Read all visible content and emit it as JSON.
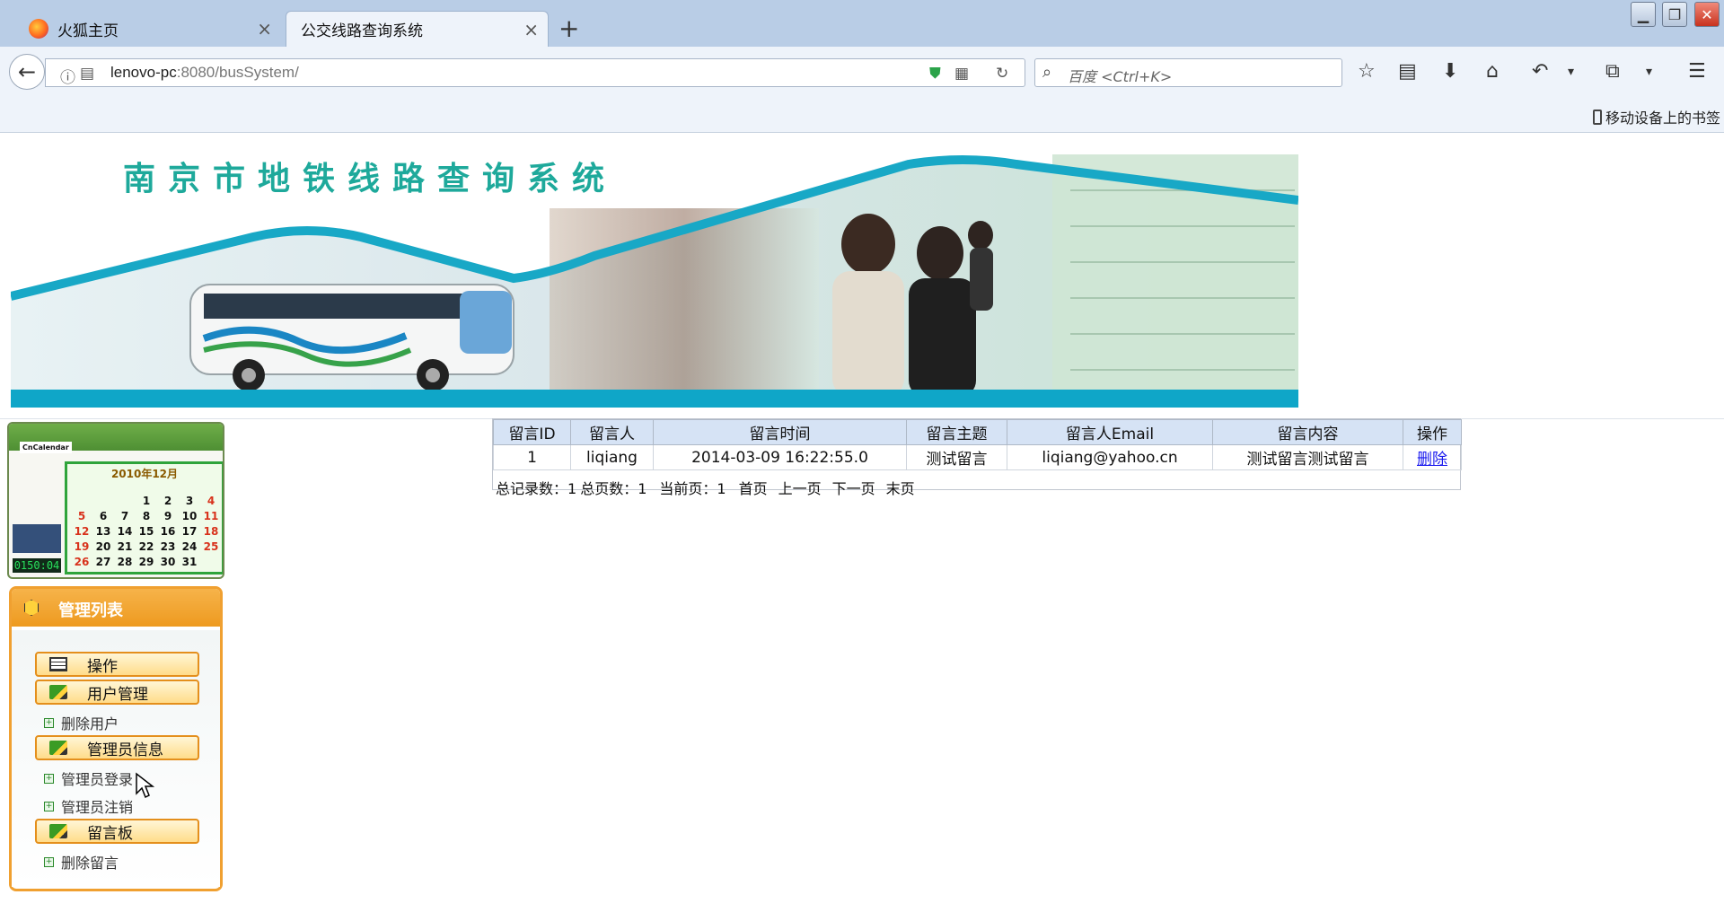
{
  "browser": {
    "tabs": [
      {
        "title": "火狐主页",
        "active": false
      },
      {
        "title": "公交线路查询系统",
        "active": true
      }
    ],
    "url_host": "lenovo-pc",
    "url_rest": ":8080/busSystem/",
    "search_placeholder": "百度 <Ctrl+K>",
    "bookmark_mobile": "移动设备上的书签",
    "new_tab": "+",
    "tab_close": "×"
  },
  "banner": {
    "title": "南京市地铁线路查询系统"
  },
  "calendar": {
    "brand": "CnCalendar",
    "month_title": "2010年12月",
    "days": [
      "",
      "",
      "",
      "1",
      "2",
      "3",
      "4",
      "5",
      "6",
      "7",
      "8",
      "9",
      "10",
      "11",
      "12",
      "13",
      "14",
      "15",
      "16",
      "17",
      "18",
      "19",
      "20",
      "21",
      "22",
      "23",
      "24",
      "25",
      "26",
      "27",
      "28",
      "29",
      "30",
      "31",
      ""
    ],
    "clock": "0150:04"
  },
  "mgmt": {
    "title": "管理列表",
    "items": [
      {
        "type": "button",
        "label": "操作",
        "icon": "list-icon"
      },
      {
        "type": "button",
        "label": "用户管理",
        "icon": "pencil-icon"
      },
      {
        "type": "link",
        "label": "删除用户"
      },
      {
        "type": "button",
        "label": "管理员信息",
        "icon": "pencil-icon"
      },
      {
        "type": "link",
        "label": "管理员登录"
      },
      {
        "type": "link",
        "label": "管理员注销"
      },
      {
        "type": "button",
        "label": "留言板",
        "icon": "pencil-icon"
      },
      {
        "type": "link",
        "label": "删除留言"
      }
    ]
  },
  "table": {
    "headers": [
      "留言ID",
      "留言人",
      "留言时间",
      "留言主题",
      "留言人Email",
      "留言内容",
      "操作"
    ],
    "rows": [
      [
        "1",
        "liqiang",
        "2014-03-09 16:22:55.0",
        "测试留言",
        "liqiang@yahoo.cn",
        "测试留言测试留言",
        "删除"
      ]
    ]
  },
  "pager": {
    "total_records_label": "总记录数：1",
    "total_pages_label": "总页数：1",
    "current_page_label": "当前页：1",
    "first": "首页",
    "prev": "上一页",
    "next": "下一页",
    "last": "末页"
  },
  "colors": {
    "banner_title": "#1ea99b",
    "mgmt_orange": "#f0a030",
    "table_header": "#d6e3f5",
    "link": "#1a1aee"
  }
}
